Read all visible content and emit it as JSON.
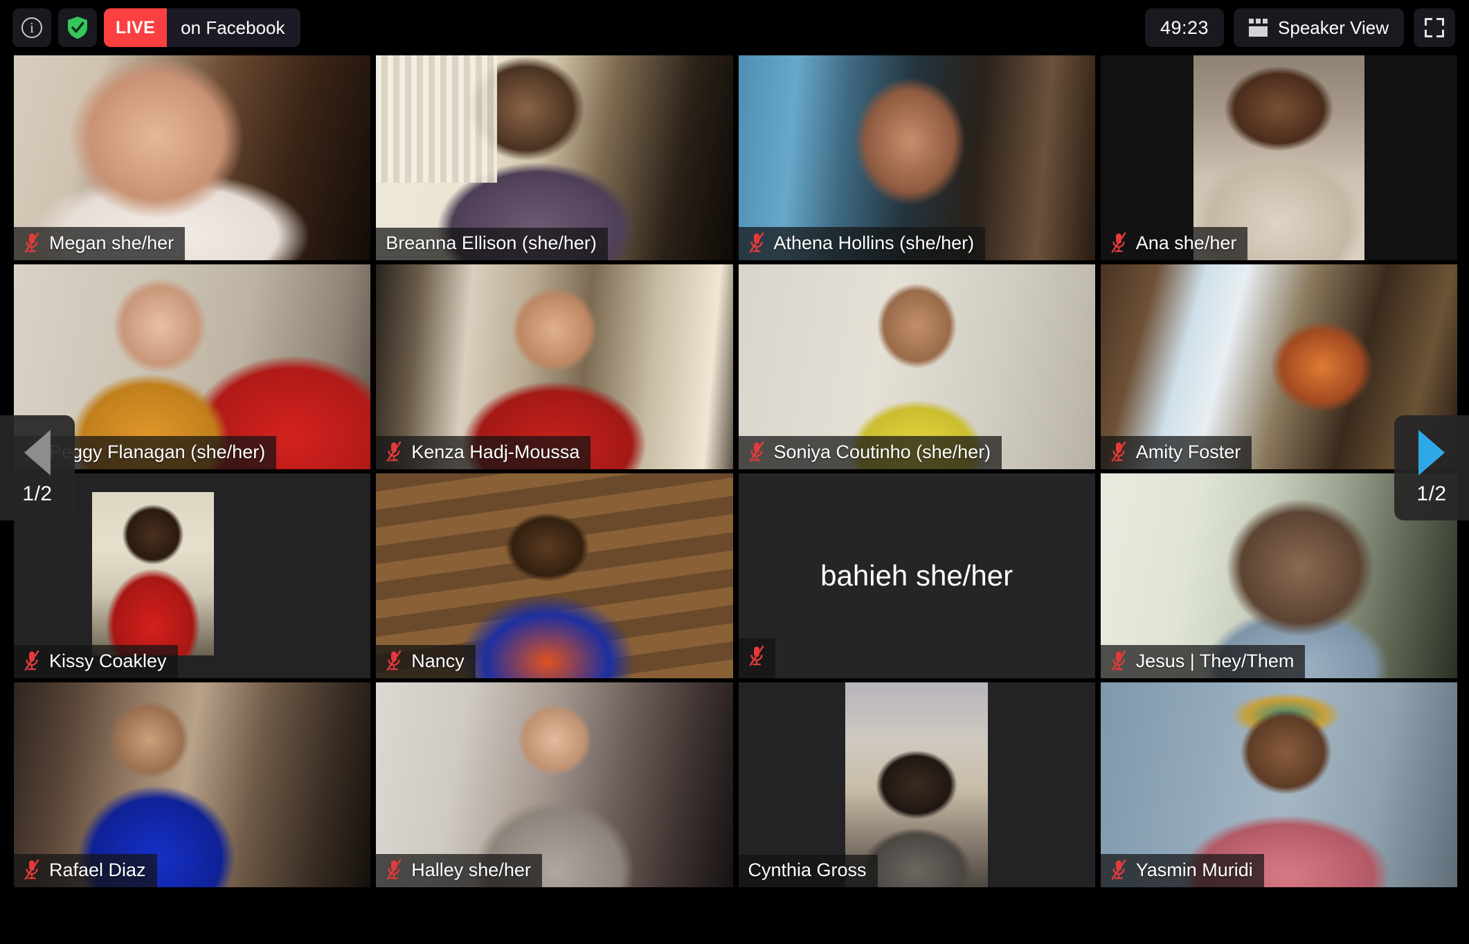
{
  "topbar": {
    "info_icon": "info-circle-icon",
    "security_icon": "shield-check-icon",
    "live_label": "LIVE",
    "stream_target": "on Facebook",
    "timer": "49:23",
    "view_mode_label": "Speaker View",
    "view_mode_icon": "gallery-grid-icon",
    "fullscreen_icon": "fullscreen-icon",
    "live_color": "#fa4040",
    "shield_color": "#35c65c"
  },
  "nav": {
    "prev_icon": "chevron-left-icon",
    "prev_page_label": "1/2",
    "prev_enabled": false,
    "next_icon": "chevron-right-icon",
    "next_page_label": "1/2",
    "next_enabled": true,
    "next_color": "#2fa8e8",
    "prev_color": "#8d8d8d"
  },
  "gallery": {
    "active_speaker_border_color": "#ccdf7e",
    "mute_icon": "microphone-muted-icon",
    "mute_icon_color": "#e33a3a",
    "columns": 4,
    "rows": 4,
    "participants": [
      {
        "name": "Megan she/her",
        "muted": true,
        "video_on": true,
        "active": false
      },
      {
        "name": "Breanna Ellison (she/her)",
        "muted": false,
        "video_on": true,
        "active": false
      },
      {
        "name": "Athena Hollins (she/her)",
        "muted": true,
        "video_on": true,
        "active": false
      },
      {
        "name": "Ana she/her",
        "muted": true,
        "video_on": true,
        "active": false
      },
      {
        "name": "Peggy Flanagan (she/her)",
        "muted": true,
        "video_on": true,
        "active": false
      },
      {
        "name": "Kenza Hadj-Moussa",
        "muted": true,
        "video_on": true,
        "active": false
      },
      {
        "name": "Soniya Coutinho (she/her)",
        "muted": true,
        "video_on": true,
        "active": false
      },
      {
        "name": "Amity Foster",
        "muted": true,
        "video_on": true,
        "active": false
      },
      {
        "name": "Kissy Coakley",
        "muted": true,
        "video_on": true,
        "active": false
      },
      {
        "name": "Nancy",
        "muted": true,
        "video_on": true,
        "active": false
      },
      {
        "name": "bahieh she/her",
        "muted": true,
        "video_on": false,
        "active": false
      },
      {
        "name": "Jesus | They/Them",
        "muted": true,
        "video_on": true,
        "active": false
      },
      {
        "name": "Rafael Diaz",
        "muted": true,
        "video_on": true,
        "active": false
      },
      {
        "name": "Halley she/her",
        "muted": true,
        "video_on": true,
        "active": false
      },
      {
        "name": "Cynthia Gross",
        "muted": false,
        "video_on": true,
        "active": true
      },
      {
        "name": "Yasmin Muridi",
        "muted": true,
        "video_on": true,
        "active": false
      }
    ]
  }
}
